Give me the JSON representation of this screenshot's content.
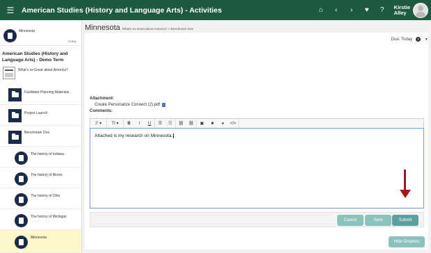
{
  "header": {
    "title": "American Studies (History and Language Arts) - Activities",
    "user_first": "Kirstie",
    "user_last": "Alley",
    "icons": [
      "menu-icon",
      "home-icon",
      "chevron-left-icon",
      "chevron-right-icon",
      "heart-icon",
      "help-icon"
    ]
  },
  "sidebar": {
    "top_item": {
      "label": "Minnesota",
      "date": "Today"
    },
    "term_title": "American Studies (History and Language Arts) - Demo Term",
    "course_item": "What's so Great about America?",
    "folders": [
      {
        "label": "Facilitator Planning Materials"
      },
      {
        "label": "Project Launch"
      },
      {
        "label": "Benchmark One"
      }
    ],
    "activities": [
      {
        "label": "The history of Indiana"
      },
      {
        "label": "The history of Illinois"
      },
      {
        "label": "The history of Ohio"
      },
      {
        "label": "The history of Michigan"
      },
      {
        "label": "Minnesota"
      }
    ]
  },
  "main": {
    "title": "Minnesota",
    "breadcrumb": "What's so Great about America? > Benchmark One",
    "due_label": "Due: Today",
    "attachment_label": "Attachment:",
    "attachment_file": "Create Personalize Connect (2).pdf",
    "comments_label": "Comments:",
    "toolbar": {
      "font": "ℱ ▾",
      "size": "TI ▾",
      "bold": "B",
      "italic": "I",
      "underline": "U",
      "bullets": "☰",
      "numbers": "☷",
      "link": "⛓",
      "unlink": "⛓",
      "image": "▣",
      "video": "■",
      "mic": "●",
      "code": "</>"
    },
    "editor_text": "Attached is my research on Minnesota.",
    "buttons": {
      "cancel": "Cancel",
      "save": "Save",
      "submit": "Submit",
      "hide": "Hide Dropbox"
    }
  },
  "colors": {
    "header": "#1e5a40",
    "navy": "#1a2b4a",
    "button": "#8cc2bd",
    "submit": "#5e9fa0",
    "arrow": "#a61515",
    "active": "#fdf7c9"
  }
}
